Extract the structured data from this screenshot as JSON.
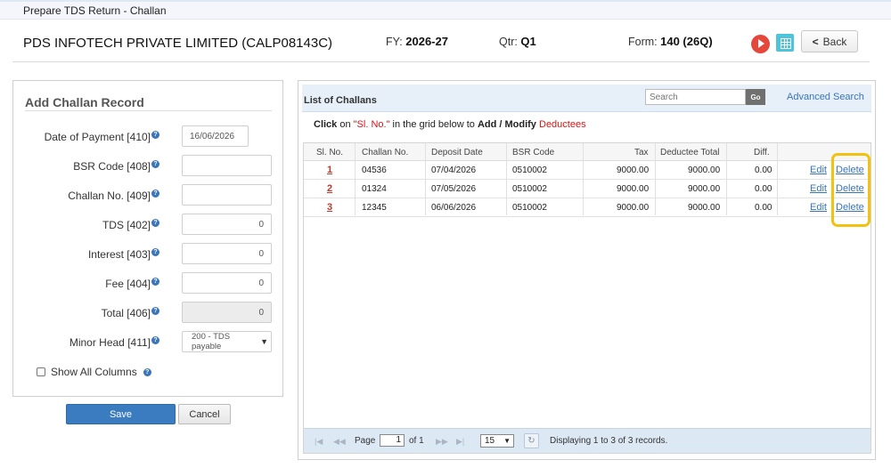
{
  "window": {
    "title": "Prepare TDS Return - Challan"
  },
  "header": {
    "company": "PDS INFOTECH PRIVATE LIMITED (CALP08143C)",
    "fy_label": "FY:",
    "fy_value": "2026-27",
    "qtr_label": "Qtr:",
    "qtr_value": "Q1",
    "form_label": "Form:",
    "form_value": "140 (26Q)",
    "back_label": "Back"
  },
  "add_challan": {
    "title": "Add Challan Record",
    "fields": [
      {
        "label": "Date of Payment [410]",
        "value": "16/06/2026"
      },
      {
        "label": "BSR Code [408]",
        "value": ""
      },
      {
        "label": "Challan No. [409]",
        "value": ""
      },
      {
        "label": "TDS [402]",
        "value": "0"
      },
      {
        "label": "Interest [403]",
        "value": "0"
      },
      {
        "label": "Fee [404]",
        "value": "0"
      },
      {
        "label": "Total [406]",
        "value": "0"
      },
      {
        "label": "Minor Head [411]",
        "value": "200 - TDS payable"
      }
    ],
    "show_all_columns": "Show All Columns",
    "save_label": "Save",
    "cancel_label": "Cancel"
  },
  "list": {
    "title": "List of Challans",
    "search_placeholder": "Search",
    "go_label": "Go",
    "advanced_search": "Advanced Search",
    "instr_1": "Click",
    "instr_2": " on ",
    "instr_3": "\"Sl. No.\"",
    "instr_4": " in the grid below to ",
    "instr_5": "Add / Modify",
    "instr_6": "Deductees",
    "columns": [
      "Sl. No.",
      "Challan No.",
      "Deposit Date",
      "BSR Code",
      "Tax",
      "Deductee Total",
      "Diff."
    ],
    "rows": [
      {
        "sl": "1",
        "challan": "04536",
        "date": "07/04/2026",
        "bsr": "0510002",
        "tax": "9000.00",
        "deductee": "9000.00",
        "diff": "0.00",
        "edit": "Edit",
        "delete": "Delete"
      },
      {
        "sl": "2",
        "challan": "01324",
        "date": "07/05/2026",
        "bsr": "0510002",
        "tax": "9000.00",
        "deductee": "9000.00",
        "diff": "0.00",
        "edit": "Edit",
        "delete": "Delete"
      },
      {
        "sl": "3",
        "challan": "12345",
        "date": "06/06/2026",
        "bsr": "0510002",
        "tax": "9000.00",
        "deductee": "9000.00",
        "diff": "0.00",
        "edit": "Edit",
        "delete": "Delete"
      }
    ],
    "pager": {
      "page_label": "Page",
      "page_value": "1",
      "of_label": "of 1",
      "page_size": "15",
      "display_text": "Displaying 1 to 3 of 3 records."
    }
  },
  "colors": {
    "accent": "#3b7bbf",
    "highlight": "#f2c20f",
    "link": "#3a74b9",
    "sl_red": "#c0392b"
  }
}
